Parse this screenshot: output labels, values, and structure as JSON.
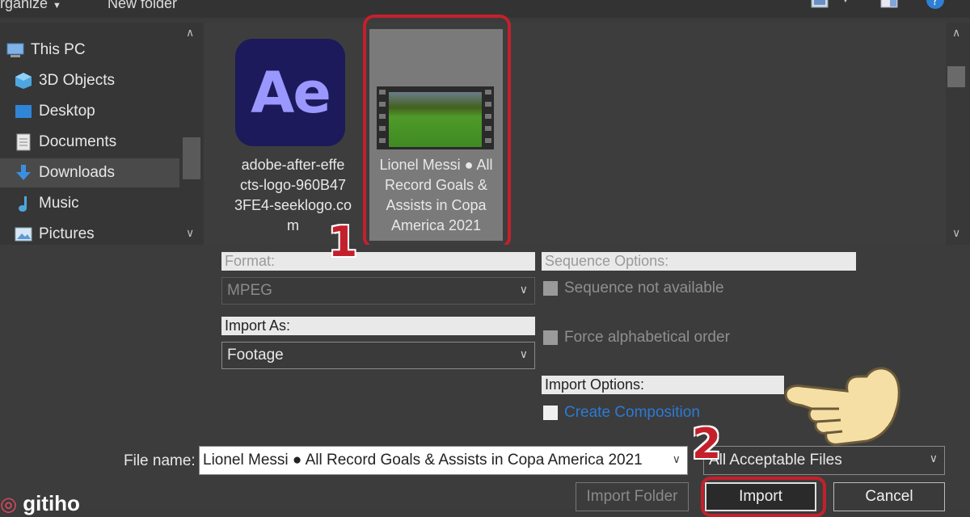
{
  "toolbar": {
    "organize_label": "rganize",
    "new_folder_label": "New folder"
  },
  "nav": {
    "items": [
      {
        "label": "This PC",
        "icon": "computer-icon"
      },
      {
        "label": "3D Objects",
        "icon": "cube-icon"
      },
      {
        "label": "Desktop",
        "icon": "desktop-icon"
      },
      {
        "label": "Documents",
        "icon": "document-icon"
      },
      {
        "label": "Downloads",
        "icon": "download-icon"
      },
      {
        "label": "Music",
        "icon": "music-note-icon"
      },
      {
        "label": "Pictures",
        "icon": "pictures-icon"
      }
    ],
    "selected": "Downloads"
  },
  "files": [
    {
      "name_lines": [
        "adobe-after-effe",
        "cts-logo-960B47",
        "3FE4-seeklogo.co",
        "m"
      ],
      "logo_text": "Ae",
      "selected": false
    },
    {
      "name_lines": [
        "Lionel Messi ● All",
        "Record Goals &",
        "Assists in Copa",
        "America 2021"
      ],
      "selected": true
    }
  ],
  "options": {
    "format_label": "Format:",
    "format_value": "MPEG",
    "import_as_label": "Import As:",
    "import_as_value": "Footage",
    "sequence_options_label": "Sequence Options:",
    "sequence_not_available": "Sequence not available",
    "force_alphabetical": "Force alphabetical order",
    "import_options_label": "Import Options:",
    "create_composition": "Create Composition"
  },
  "file_name": {
    "label": "File name:",
    "value": "Lionel Messi ● All Record Goals & Assists in Copa America 2021"
  },
  "filter": {
    "value": "All Acceptable Files"
  },
  "buttons": {
    "import_folder": "Import Folder",
    "import": "Import",
    "cancel": "Cancel"
  },
  "annotations": {
    "step1": "1",
    "step2": "2",
    "watermark": "gitiho"
  },
  "colors": {
    "highlight_red": "#c4202c",
    "link_blue": "#2a7bd4"
  }
}
